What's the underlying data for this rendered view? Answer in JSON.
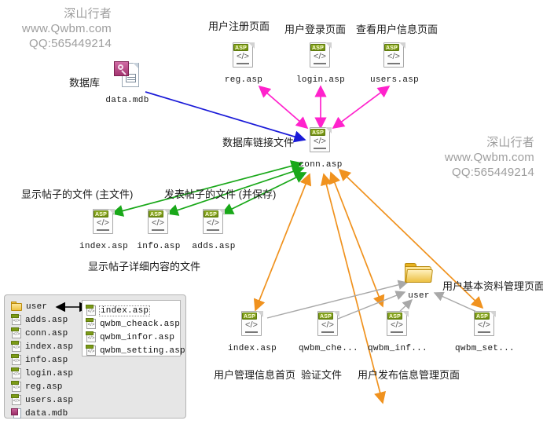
{
  "watermarks": {
    "left": {
      "brand": "深山行者",
      "site": "www.Qwbm.com",
      "qq": "QQ:565449214"
    },
    "right": {
      "brand": "深山行者",
      "site": "www.Qwbm.com",
      "qq": "QQ:565449214"
    }
  },
  "colors": {
    "db_link": "#1a1ad8",
    "auth_link": "#ff22cc",
    "post_link": "#19a819",
    "user_link": "#f0921e",
    "folder_link": "#a8a8a8",
    "asp_tag": "#7b9a16",
    "folder": "#eec23f",
    "watermark_text": "#9e9e9e",
    "legend_bg": "#e6e6e6"
  },
  "nodes": {
    "database": {
      "label": "数据库",
      "file": "data.mdb",
      "icon": "mdb-file-icon"
    },
    "reg": {
      "caption": "用户注册页面",
      "file": "reg.asp",
      "icon": "asp-file-icon"
    },
    "login": {
      "caption": "用户登录页面",
      "file": "login.asp",
      "icon": "asp-file-icon"
    },
    "users": {
      "caption": "查看用户信息页面",
      "file": "users.asp",
      "icon": "asp-file-icon"
    },
    "conn": {
      "caption": "数据库链接文件",
      "file": "conn.asp",
      "icon": "asp-file-icon"
    },
    "index_bbs": {
      "caption": "显示帖子的文件 (主文件)",
      "file": "index.asp",
      "icon": "asp-file-icon"
    },
    "info_bbs": {
      "caption": "显示帖子详细内容的文件",
      "file": "info.asp",
      "icon": "asp-file-icon"
    },
    "adds_bbs": {
      "caption": "发表帖子的文件 (并保存)",
      "file": "adds.asp",
      "icon": "asp-file-icon"
    },
    "user_folder": {
      "file": "user",
      "icon": "folder-icon"
    },
    "u_index": {
      "caption": "用户管理信息首页",
      "file": "index.asp",
      "icon": "asp-file-icon"
    },
    "u_cheack": {
      "caption": "验证文件",
      "file": "qwbm_che...",
      "icon": "asp-file-icon"
    },
    "u_infor": {
      "caption": "用户发布信息管理页面",
      "file": "qwbm_inf...",
      "icon": "asp-file-icon"
    },
    "u_setting": {
      "caption": "用户基本资料管理页面",
      "file": "qwbm_set...",
      "icon": "asp-file-icon"
    }
  },
  "legend": {
    "root_items": [
      {
        "name": "user",
        "icon": "folder-icon"
      },
      {
        "name": "adds.asp",
        "icon": "asp-file-icon"
      },
      {
        "name": "conn.asp",
        "icon": "asp-file-icon"
      },
      {
        "name": "index.asp",
        "icon": "asp-file-icon"
      },
      {
        "name": "info.asp",
        "icon": "asp-file-icon"
      },
      {
        "name": "login.asp",
        "icon": "asp-file-icon"
      },
      {
        "name": "reg.asp",
        "icon": "asp-file-icon"
      },
      {
        "name": "users.asp",
        "icon": "asp-file-icon"
      },
      {
        "name": "data.mdb",
        "icon": "mdb-file-icon"
      }
    ],
    "user_folder_items": [
      {
        "name": "index.asp",
        "icon": "asp-file-icon",
        "selected": true
      },
      {
        "name": "qwbm_cheack.asp",
        "icon": "asp-file-icon",
        "selected": false
      },
      {
        "name": "qwbm_infor.asp",
        "icon": "asp-file-icon",
        "selected": false
      },
      {
        "name": "qwbm_setting.asp",
        "icon": "asp-file-icon",
        "selected": false
      }
    ]
  }
}
